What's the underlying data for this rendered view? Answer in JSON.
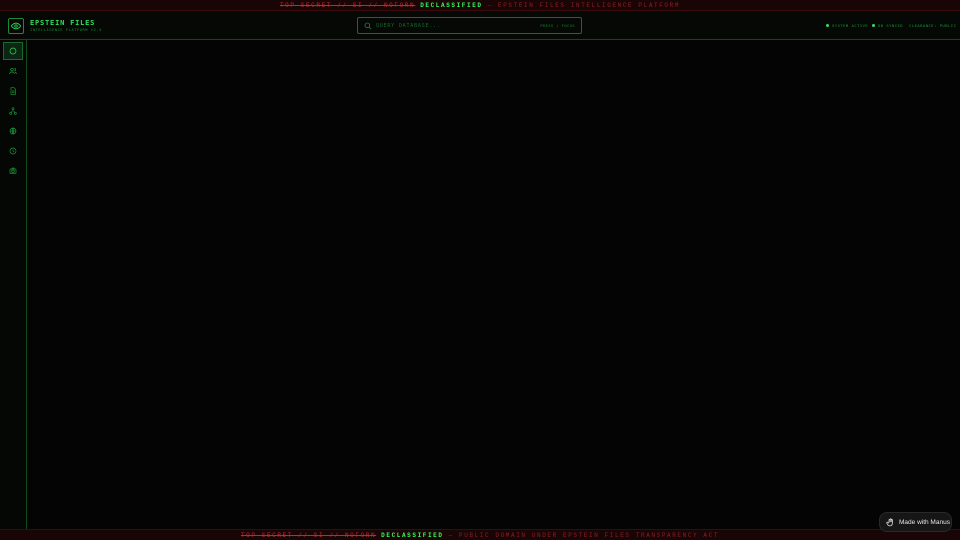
{
  "banner_top": {
    "classification": "TOP SECRET // SI // NOFORN",
    "declassified": "DECLASSIFIED",
    "rest": "— EPSTEIN FILES INTELLIGENCE PLATFORM"
  },
  "banner_bottom": {
    "classification": "TOP SECRET // SI // NOFORN",
    "declassified": "DECLASSIFIED",
    "rest": "— PUBLIC DOMAIN UNDER EPSTEIN FILES TRANSPARENCY ACT"
  },
  "header": {
    "title": "EPSTEIN FILES",
    "subtitle": "INTELLIGENCE PLATFORM v2.4",
    "logo_icon": "eye-icon"
  },
  "search": {
    "placeholder": "QUERY DATABASE...",
    "shortcut": "PRESS / FOCUS"
  },
  "status": {
    "system": "SYSTEM ACTIVE",
    "records": "DB SYNCED",
    "clearance": "CLEARANCE: PUBLIC"
  },
  "sidebar": {
    "items": [
      {
        "icon": "dashboard-icon",
        "active": true
      },
      {
        "icon": "people-icon",
        "active": false
      },
      {
        "icon": "document-icon",
        "active": false
      },
      {
        "icon": "network-icon",
        "active": false
      },
      {
        "icon": "globe-icon",
        "active": false
      },
      {
        "icon": "clock-icon",
        "active": false
      },
      {
        "icon": "camera-icon",
        "active": false
      }
    ]
  },
  "badge": {
    "label": "Made with Manus"
  },
  "colors": {
    "accent": "#2de05a",
    "accent_dim": "#1a8a34",
    "alert": "#c0282b",
    "background": "#050505"
  }
}
